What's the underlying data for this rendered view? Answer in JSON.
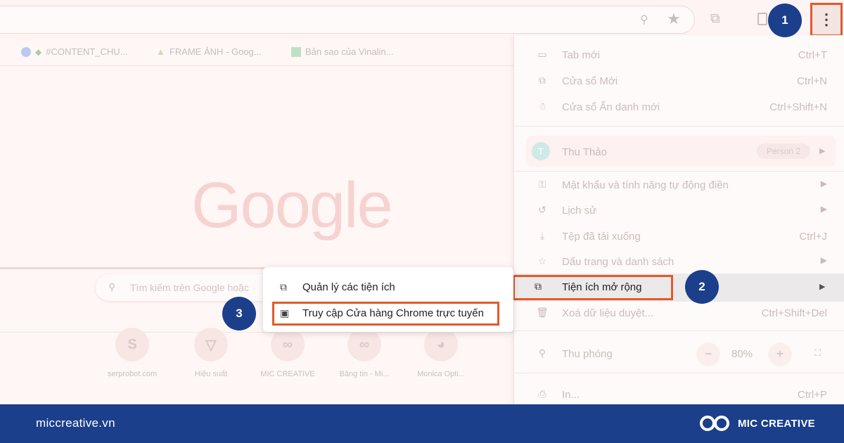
{
  "bookmarks": [
    {
      "label": "#CONTENT_CHU...",
      "icon": "facebook-icon"
    },
    {
      "label": "FRAME ẢNH - Goog...",
      "icon": "google-drive-icon"
    },
    {
      "label": "Bản sao của Vinalin...",
      "icon": "google-sheets-icon"
    }
  ],
  "page": {
    "logo": "Google",
    "search_placeholder": "Tìm kiếm trên Google hoặc",
    "shortcuts": [
      {
        "label": "serprobot.com",
        "glyph": "S"
      },
      {
        "label": "Hiệu suất",
        "glyph": "▽"
      },
      {
        "label": "MIC CREATIVE",
        "glyph": "∞"
      },
      {
        "label": "Bảng tin - Mi...",
        "glyph": "∞"
      },
      {
        "label": "Monica Opti...",
        "glyph": "◕"
      }
    ]
  },
  "chrome_menu": {
    "items": [
      {
        "label": "Tab mới",
        "shortcut": "Ctrl+T",
        "icon": "new-tab-icon"
      },
      {
        "label": "Cửa sổ Mới",
        "shortcut": "Ctrl+N",
        "icon": "new-window-icon"
      },
      {
        "label": "Cửa sổ Ẩn danh mới",
        "shortcut": "Ctrl+Shift+N",
        "icon": "incognito-icon"
      }
    ],
    "profile": {
      "name": "Thu Thảo",
      "initial": "T",
      "chip": "Person 2"
    },
    "items2": [
      {
        "label": "Mật khẩu và tính năng tự động điền",
        "icon": "key-icon",
        "arrow": "▶"
      },
      {
        "label": "Lịch sử",
        "icon": "history-icon",
        "arrow": "▶"
      },
      {
        "label": "Tệp đã tải xuống",
        "icon": "download-icon",
        "shortcut": "Ctrl+J"
      },
      {
        "label": "Dấu trang và danh sách",
        "icon": "star-icon",
        "arrow": "▶"
      }
    ],
    "extensions": {
      "label": "Tiện ích mở rộng",
      "arrow": "▶"
    },
    "clear_data": {
      "label": "Xoá dữ liệu duyệt...",
      "shortcut": "Ctrl+Shift+Del"
    },
    "zoom": {
      "label": "Thu phóng",
      "value": "80%",
      "minus": "−",
      "plus": "+"
    },
    "print": {
      "label": "In...",
      "shortcut": "Ctrl+P"
    }
  },
  "submenu": {
    "manage": "Quản lý các tiện ích",
    "store": "Truy cập Cửa hàng Chrome trực tuyến"
  },
  "steps": [
    "1",
    "2",
    "3"
  ],
  "footer": {
    "site": "miccreative.vn",
    "brand": "MIC CREATIVE"
  },
  "colors": {
    "accent": "#e05a2b",
    "step_badge": "#1b3f8b",
    "footer_bg": "#1b3f8b"
  }
}
